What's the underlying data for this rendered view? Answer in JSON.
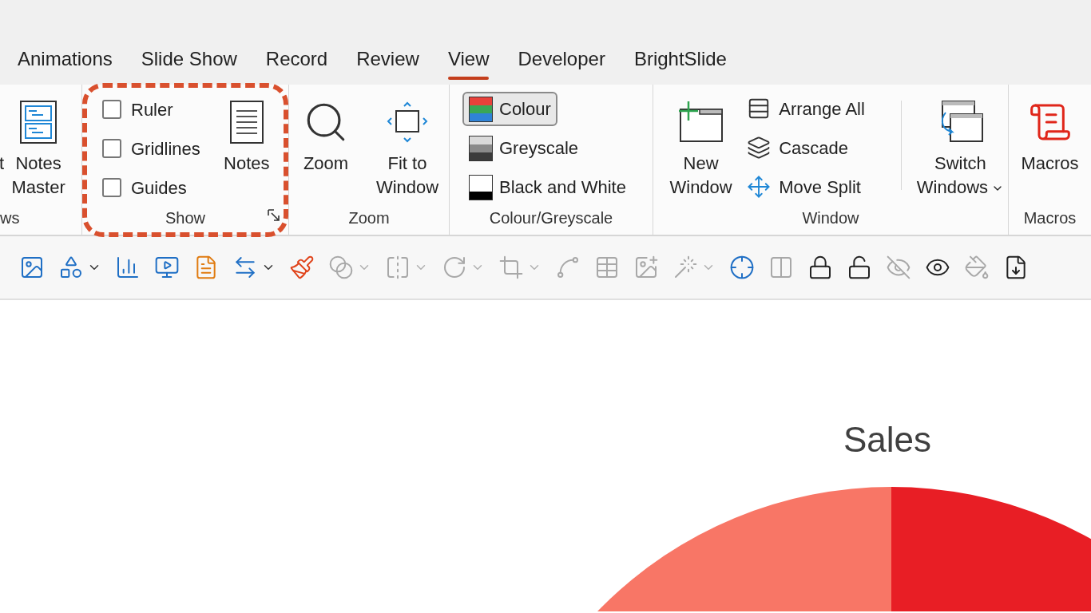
{
  "tabs": [
    {
      "label": "Animations",
      "selected": false
    },
    {
      "label": "Slide Show",
      "selected": false
    },
    {
      "label": "Record",
      "selected": false
    },
    {
      "label": "Review",
      "selected": false
    },
    {
      "label": "View",
      "selected": true
    },
    {
      "label": "Developer",
      "selected": false
    },
    {
      "label": "BrightSlide",
      "selected": false
    }
  ],
  "ribbon": {
    "views_group": {
      "label": "ws",
      "cut_text": "t",
      "button": {
        "label": "Notes Master"
      }
    },
    "show_group": {
      "label": "Show",
      "checkboxes": [
        {
          "label": "Ruler",
          "checked": false
        },
        {
          "label": "Gridlines",
          "checked": false
        },
        {
          "label": "Guides",
          "checked": false
        }
      ],
      "notes_button": {
        "label": "Notes"
      }
    },
    "zoom_group": {
      "label": "Zoom",
      "buttons": [
        {
          "label": "Zoom"
        },
        {
          "label": "Fit to Window"
        }
      ]
    },
    "colour_group": {
      "label": "Colour/Greyscale",
      "options": [
        {
          "label": "Colour",
          "selected": true
        },
        {
          "label": "Greyscale",
          "selected": false
        },
        {
          "label": "Black and White",
          "selected": false
        }
      ]
    },
    "window_group": {
      "label": "Window",
      "new_window": {
        "label": "New Window"
      },
      "small_buttons": [
        {
          "label": "Arrange All"
        },
        {
          "label": "Cascade"
        },
        {
          "label": "Move Split"
        }
      ],
      "switch_windows": {
        "label": "Switch Windows"
      }
    },
    "macros_group": {
      "label": "Macros",
      "button": {
        "label": "Macros"
      }
    }
  },
  "toolbar": [
    {
      "disabled": false,
      "menu": false
    },
    {
      "disabled": false,
      "menu": true
    },
    {
      "disabled": false,
      "menu": false
    },
    {
      "disabled": false,
      "menu": false
    },
    {
      "disabled": false,
      "menu": false
    },
    {
      "disabled": false,
      "menu": true
    },
    {
      "disabled": false,
      "menu": false
    },
    {
      "disabled": true,
      "menu": true
    },
    {
      "disabled": true,
      "menu": true
    },
    {
      "disabled": true,
      "menu": true
    },
    {
      "disabled": true,
      "menu": true
    },
    {
      "disabled": true,
      "menu": false
    },
    {
      "disabled": true,
      "menu": false
    },
    {
      "disabled": true,
      "menu": false
    },
    {
      "disabled": true,
      "menu": true
    },
    {
      "disabled": false,
      "menu": false
    },
    {
      "disabled": true,
      "menu": false
    },
    {
      "disabled": false,
      "menu": false
    },
    {
      "disabled": false,
      "menu": false
    },
    {
      "disabled": true,
      "menu": false
    },
    {
      "disabled": false,
      "menu": false
    },
    {
      "disabled": true,
      "menu": false
    },
    {
      "disabled": false,
      "menu": false
    }
  ],
  "slide": {
    "chart_title": "Sales"
  }
}
